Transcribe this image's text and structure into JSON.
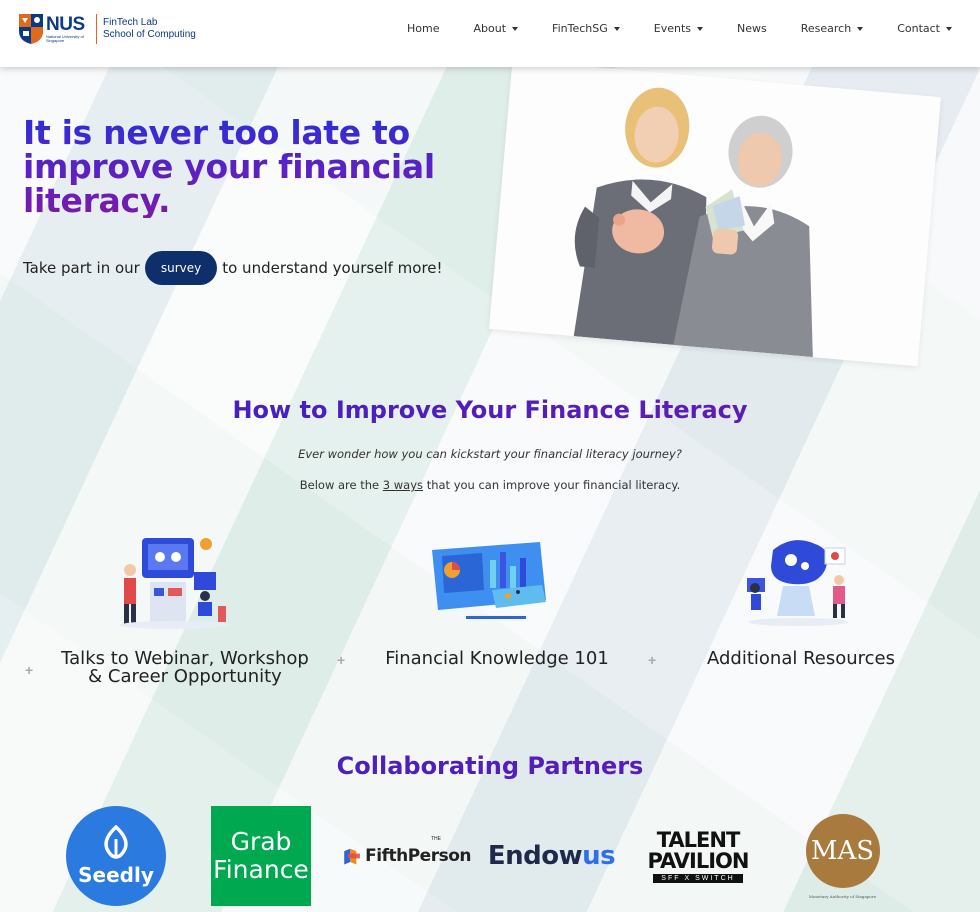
{
  "navbar": {
    "logo": {
      "nus": "NUS",
      "nus_sub": "National University of Singapore",
      "line1": "FinTech Lab",
      "line2": "School of Computing"
    },
    "items": [
      {
        "label": "Home",
        "dropdown": false
      },
      {
        "label": "About",
        "dropdown": true
      },
      {
        "label": "FinTechSG",
        "dropdown": true
      },
      {
        "label": "Events",
        "dropdown": true
      },
      {
        "label": "News",
        "dropdown": false
      },
      {
        "label": "Research",
        "dropdown": true
      },
      {
        "label": "Contact",
        "dropdown": true
      }
    ]
  },
  "hero": {
    "title_line1": "It is never too late to",
    "title_line2": "improve your financial",
    "title_line3": "literacy.",
    "sub_before": "Take part in our",
    "survey_button": "survey",
    "sub_after": "to understand yourself more!"
  },
  "improve": {
    "title": "How to Improve Your Finance Literacy",
    "intro": "Ever wonder how you can kickstart your financial literacy journey?",
    "line_before": "Below are the",
    "line_link": "3 ways",
    "line_after": "that you can improve your financial literacy.",
    "features": [
      {
        "line1": "Talks to Webinar, Workshop",
        "line2": "& Career Opportunity"
      },
      {
        "line1": "Financial Knowledge 101",
        "line2": ""
      },
      {
        "line1": "Additional Resources",
        "line2": ""
      }
    ],
    "plus_glyph": "+"
  },
  "partners": {
    "title": "Collaborating Partners",
    "seedly": "Seedly",
    "grab_line1": "Grab",
    "grab_line2": "Finance",
    "fifth": "FifthPerson",
    "fifth_the": "THE",
    "endow_a": "Endow",
    "endow_b": "us",
    "talent_line1": "TALENT",
    "talent_line2": "PAVILION",
    "talent_bar": "SFF X SWITCH",
    "mas": "MAS",
    "mas_sub": "Monetary Authority of Singapore"
  },
  "colors": {
    "navy": "#0d2f6b",
    "title_gradient_start": "#2a2fd8",
    "title_gradient_end": "#7a1aa8",
    "seedly_blue": "#2a7ae0",
    "grab_green": "#00a94f",
    "endow_blue": "#2f6fe8",
    "mas_bronze": "#a87a3e"
  }
}
